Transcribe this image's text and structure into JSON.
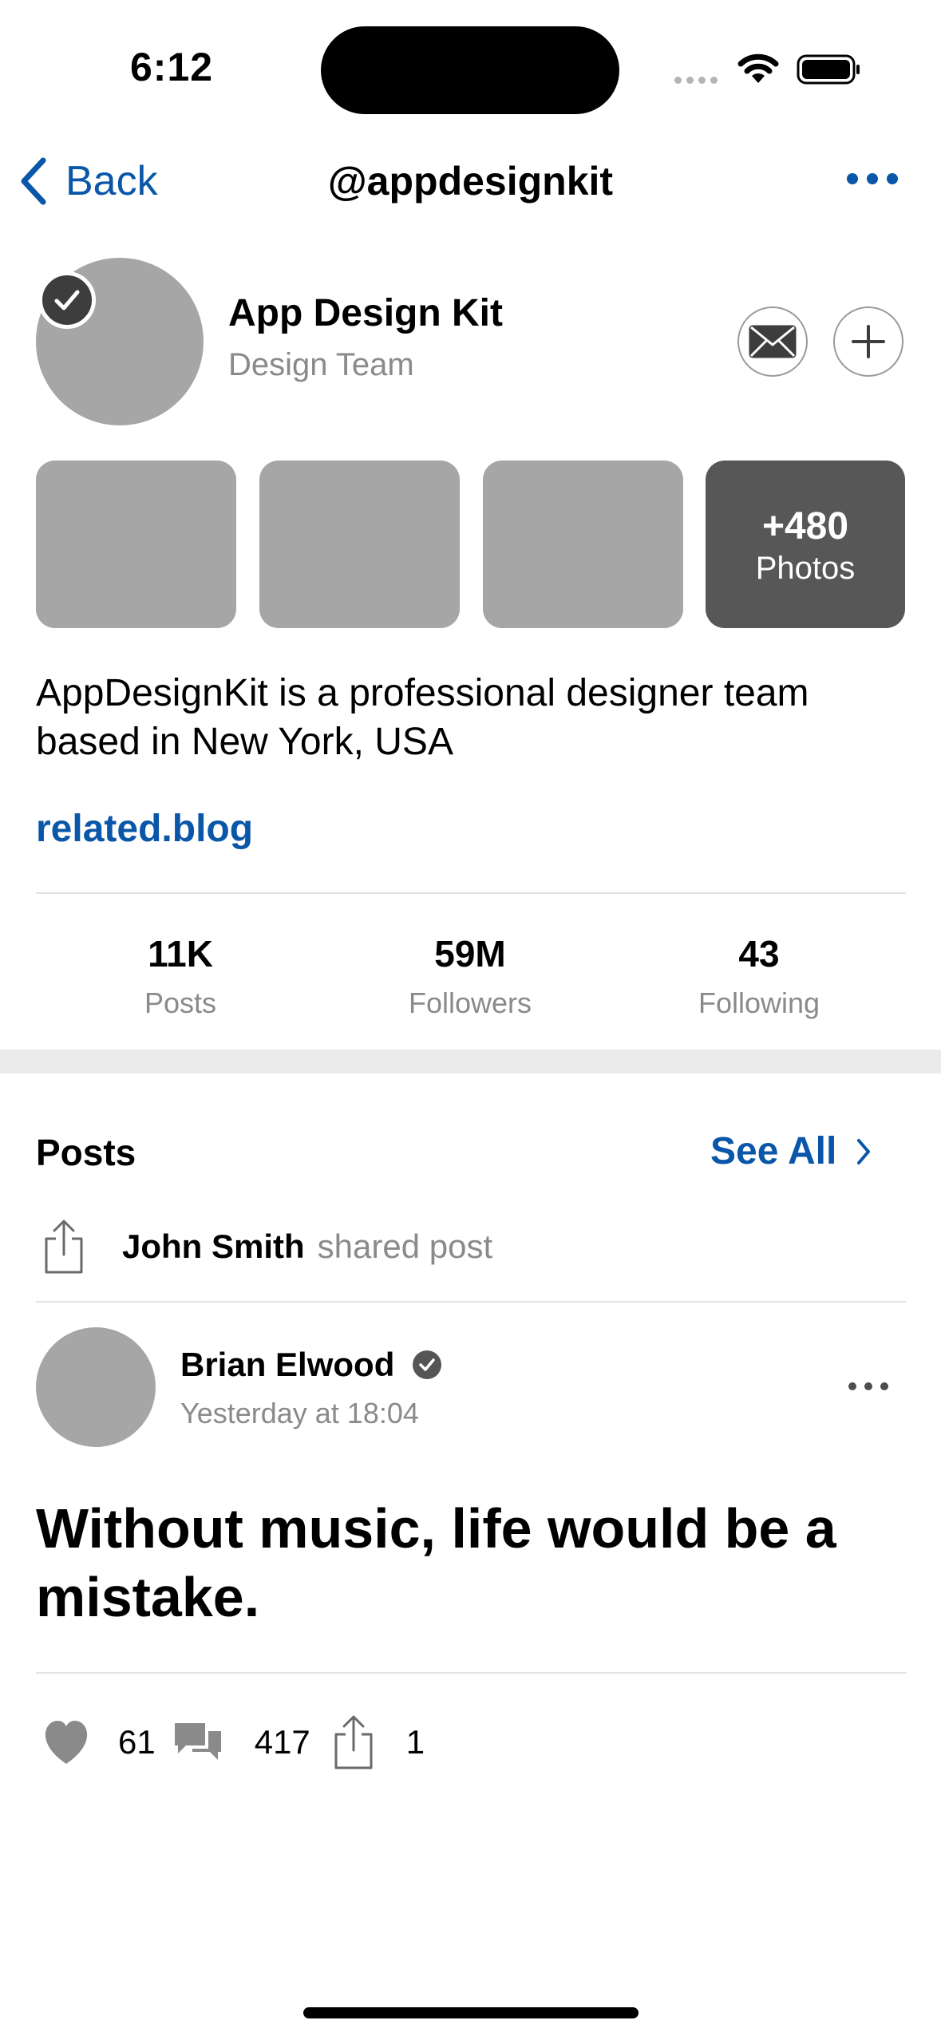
{
  "status_bar": {
    "time": "6:12"
  },
  "nav": {
    "back_label": "Back",
    "title": "@appdesignkit"
  },
  "profile": {
    "name": "App Design Kit",
    "team": "Design Team",
    "photos_more_count": "+480",
    "photos_more_label": "Photos",
    "bio": "AppDesignKit is a professional designer team based in New York, USA",
    "link": "related.blog"
  },
  "stats": [
    {
      "value": "11K",
      "label": "Posts"
    },
    {
      "value": "59M",
      "label": "Followers"
    },
    {
      "value": "43",
      "label": "Following"
    }
  ],
  "posts_section": {
    "title": "Posts",
    "see_all": "See All",
    "shared_by": "John Smith",
    "shared_text": "shared post"
  },
  "post": {
    "author": "Brian Elwood",
    "time": "Yesterday at 18:04",
    "text": "Without music, life would be a mistake.",
    "likes": "61",
    "comments": "417",
    "shares": "1"
  },
  "colors": {
    "accent": "#0a56a8",
    "placeholder": "#a6a6a6",
    "secondary_text": "#8a8a8a"
  }
}
